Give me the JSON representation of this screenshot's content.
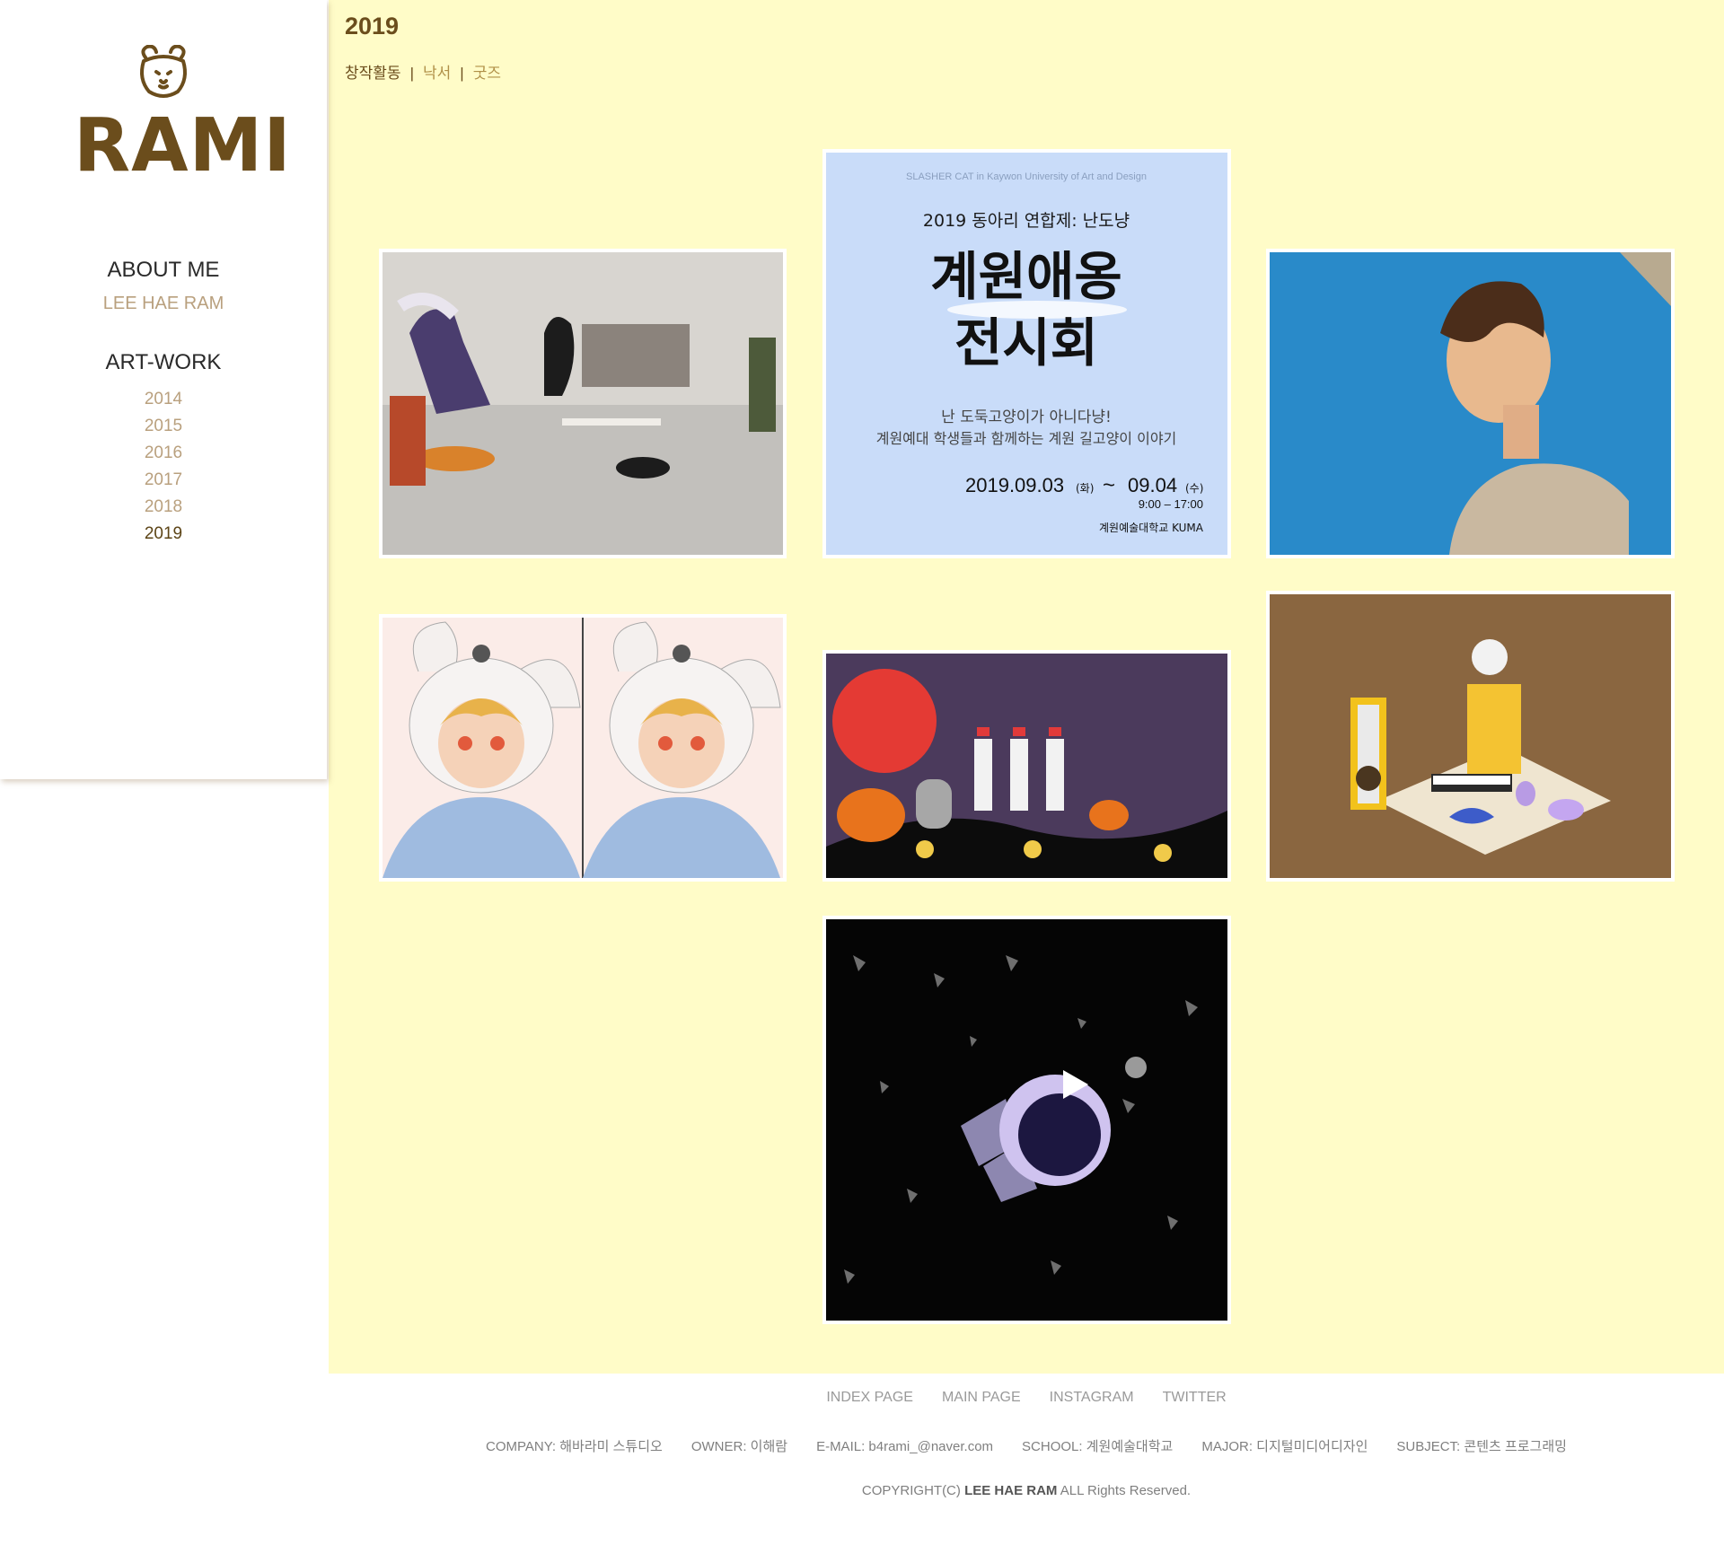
{
  "sidebar": {
    "logo_text": "RAMI",
    "about_heading": "ABOUT ME",
    "about_name": "LEE HAE RAM",
    "artwork_heading": "ART-WORK",
    "years": [
      "2014",
      "2015",
      "2016",
      "2017",
      "2018",
      "2019"
    ],
    "active_year": "2019"
  },
  "main": {
    "title": "2019",
    "categories": [
      "창작활동",
      "낙서",
      "굿즈"
    ],
    "active_category": "창작활동",
    "poster": {
      "top_line": "SLASHER CAT in Kaywon University of Art and Design",
      "subtitle": "2019 동아리 연합제: 난도냥",
      "title_line1": "계원애옹",
      "title_line2": "전시회",
      "desc_line1": "난 도둑고양이가 아니다냥!",
      "desc_line2": "계원예대 학생들과 함께하는 계원 길고양이 이야기",
      "date_start": "2019.09.03",
      "date_start_day": "(화)",
      "date_tilde": "~",
      "date_end": "09.04",
      "date_end_day": "(수)",
      "time": "9:00 – 17:00",
      "venue": "계원예술대학교 KUMA"
    }
  },
  "footer": {
    "links": [
      "INDEX PAGE",
      "MAIN PAGE",
      "INSTAGRAM",
      "TWITTER"
    ],
    "company": "COMPANY: 해바라미 스튜디오",
    "owner": "OWNER: 이해람",
    "email": "E-MAIL: b4rami_@naver.com",
    "school": "SCHOOL: 계원예술대학교",
    "major": "MAJOR: 디지털미디어디자인",
    "subject": "SUBJECT: 콘텐츠 프로그래밍",
    "copyright_prefix": "COPYRIGHT(C)",
    "copyright_name": "LEE HAE RAM",
    "copyright_suffix": "ALL Rights Reserved."
  },
  "colors": {
    "main_bg": "#fffcc8",
    "brand_brown": "#6b4d1c",
    "muted_tan": "#b9a07e"
  },
  "icons": [
    "bear-logo-icon",
    "play-icon"
  ]
}
